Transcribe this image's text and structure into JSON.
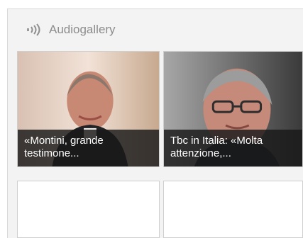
{
  "widget": {
    "title": "Audiogallery",
    "icon": "sound-waves-icon"
  },
  "items": [
    {
      "caption": "«Montini, grande testimone..."
    },
    {
      "caption": "Tbc in Italia: «Molta attenzione,..."
    },
    {
      "caption": ""
    },
    {
      "caption": ""
    }
  ]
}
